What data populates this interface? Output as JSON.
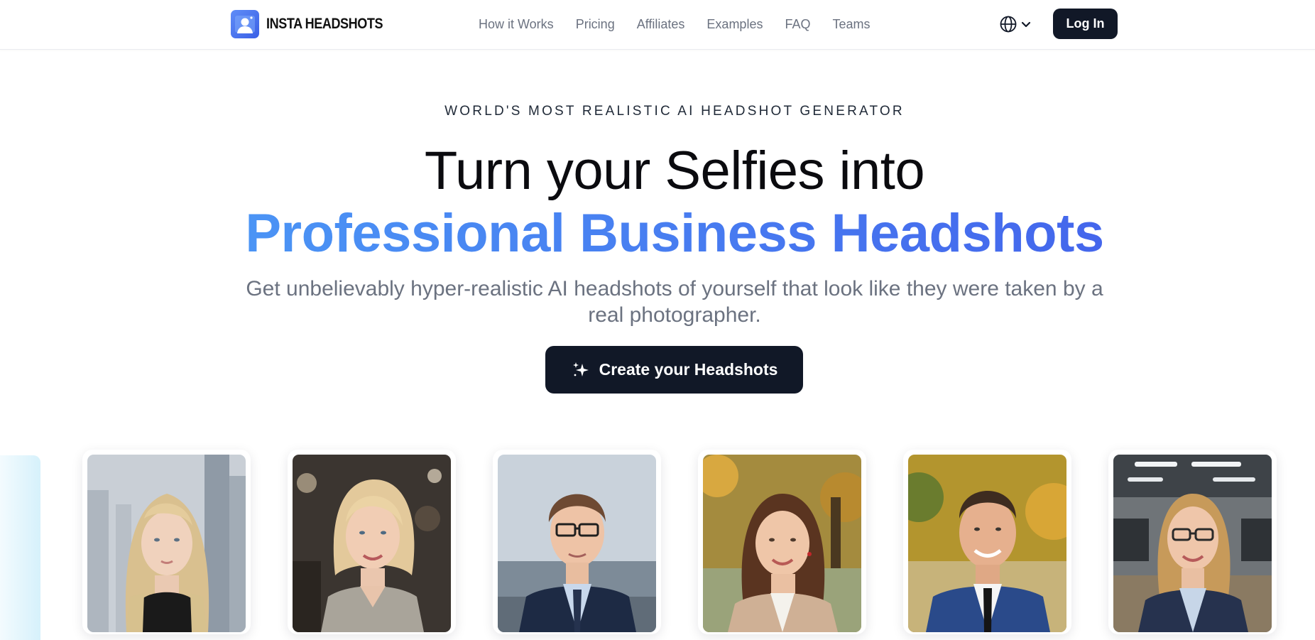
{
  "brand": {
    "name": "INSTA HEADSHOTS",
    "logo_icon": "person-portrait-icon",
    "accent": "#4466ec"
  },
  "nav": {
    "items": [
      {
        "label": "How it Works"
      },
      {
        "label": "Pricing"
      },
      {
        "label": "Affiliates"
      },
      {
        "label": "Examples"
      },
      {
        "label": "FAQ"
      },
      {
        "label": "Teams"
      }
    ],
    "language_icon": "globe-icon",
    "login_label": "Log In"
  },
  "hero": {
    "eyebrow": "WORLD'S MOST REALISTIC AI HEADSHOT GENERATOR",
    "title_line1": "Turn your Selfies into",
    "title_line2": "Professional Business Headshots",
    "subtitle": "Get unbelievably hyper-realistic AI headshots of yourself that look like they were taken by a real photographer.",
    "cta_label": "Create your Headshots",
    "cta_icon": "sparkles-icon"
  },
  "gallery": {
    "cards": [
      {
        "subject": "woman-long-blonde-hair",
        "bg": "city-skyline"
      },
      {
        "subject": "woman-short-blonde-hair",
        "bg": "office-bokeh"
      },
      {
        "subject": "man-glasses-suit",
        "bg": "sea"
      },
      {
        "subject": "woman-brown-hair-blazer",
        "bg": "autumn-trees"
      },
      {
        "subject": "man-suit-tie",
        "bg": "autumn-trees"
      },
      {
        "subject": "woman-glasses-blazer",
        "bg": "office"
      }
    ]
  }
}
